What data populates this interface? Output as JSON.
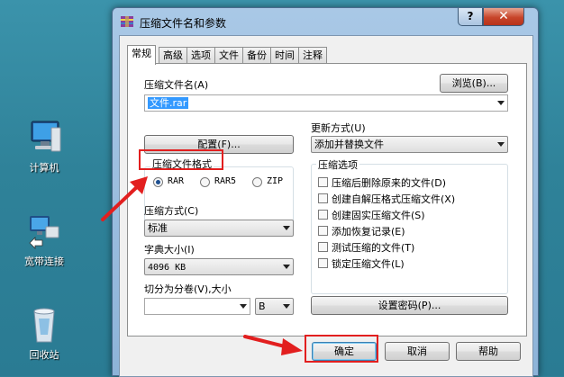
{
  "desktop": {
    "icons": [
      {
        "label": "计算机",
        "icon": "computer-icon"
      },
      {
        "label": "宽带连接",
        "icon": "network-connection-icon"
      },
      {
        "label": "回收站",
        "icon": "recycle-bin-icon"
      }
    ]
  },
  "window": {
    "title": "压缩文件名和参数",
    "help_label": "?",
    "close_label": "✕"
  },
  "tabs": [
    {
      "label": "常规",
      "active": true
    },
    {
      "label": "高级"
    },
    {
      "label": "选项"
    },
    {
      "label": "文件"
    },
    {
      "label": "备份"
    },
    {
      "label": "时间"
    },
    {
      "label": "注释"
    }
  ],
  "general": {
    "archive_name_label": "压缩文件名(A)",
    "browse_label": "浏览(B)...",
    "archive_name_value": "文件.rar",
    "update_mode_label": "更新方式(U)",
    "update_mode_value": "添加并替换文件",
    "profiles_label": "配置(F)...",
    "format_label": "压缩文件格式",
    "formats": [
      "RAR",
      "RAR5",
      "ZIP"
    ],
    "selected_format": "RAR",
    "method_label": "压缩方式(C)",
    "method_value": "标准",
    "dict_label": "字典大小(I)",
    "dict_value": "4096 KB",
    "split_label": "切分为分卷(V),大小",
    "split_value": "",
    "split_unit": "B",
    "options_label": "压缩选项",
    "options": [
      {
        "label": "压缩后删除原来的文件(D)",
        "checked": false
      },
      {
        "label": "创建自解压格式压缩文件(X)",
        "checked": false
      },
      {
        "label": "创建固实压缩文件(S)",
        "checked": false
      },
      {
        "label": "添加恢复记录(E)",
        "checked": false
      },
      {
        "label": "测试压缩的文件(T)",
        "checked": false
      },
      {
        "label": "锁定压缩文件(L)",
        "checked": false
      }
    ],
    "password_label": "设置密码(P)..."
  },
  "footer": {
    "ok_label": "确定",
    "cancel_label": "取消",
    "help_label": "帮助"
  },
  "colors": {
    "highlight": "#e21f1f",
    "selection": "#3399ff"
  }
}
